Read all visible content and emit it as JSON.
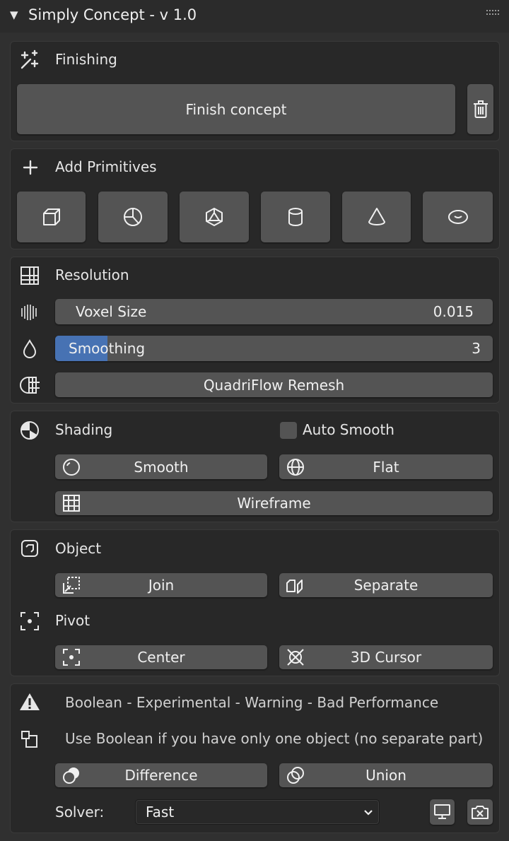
{
  "header": {
    "collapse_glyph": "▼",
    "title": "Simply Concept - v 1.0"
  },
  "finishing": {
    "title": "Finishing",
    "finish_label": "Finish concept"
  },
  "primitives": {
    "title": "Add Primitives",
    "items": [
      "cube-icon",
      "uv-sphere-icon",
      "ico-sphere-icon",
      "cylinder-icon",
      "cone-icon",
      "torus-icon"
    ]
  },
  "resolution": {
    "title": "Resolution",
    "voxel_label": "Voxel Size",
    "voxel_value": "0.015",
    "smoothing_label": "Smoothing",
    "smoothing_value": "3",
    "smoothing_fill": 0.12,
    "remesh_label": "QuadriFlow Remesh"
  },
  "shading": {
    "title": "Shading",
    "auto_smooth_label": "Auto Smooth",
    "smooth_label": "Smooth",
    "flat_label": "Flat",
    "wireframe_label": "Wireframe"
  },
  "object": {
    "title": "Object",
    "join_label": "Join",
    "separate_label": "Separate",
    "pivot_title": "Pivot",
    "center_label": "Center",
    "cursor_label": "3D Cursor"
  },
  "boolean": {
    "warning_text": "Boolean - Experimental - Warning - Bad Performance",
    "info_text": "Use Boolean if you have only one object (no separate part)",
    "difference_label": "Difference",
    "union_label": "Union",
    "solver_label": "Solver:",
    "solver_value": "Fast"
  },
  "colors": {
    "accent": "#4772b3",
    "button": "#545454",
    "panel": "#282828",
    "background": "#303030"
  }
}
